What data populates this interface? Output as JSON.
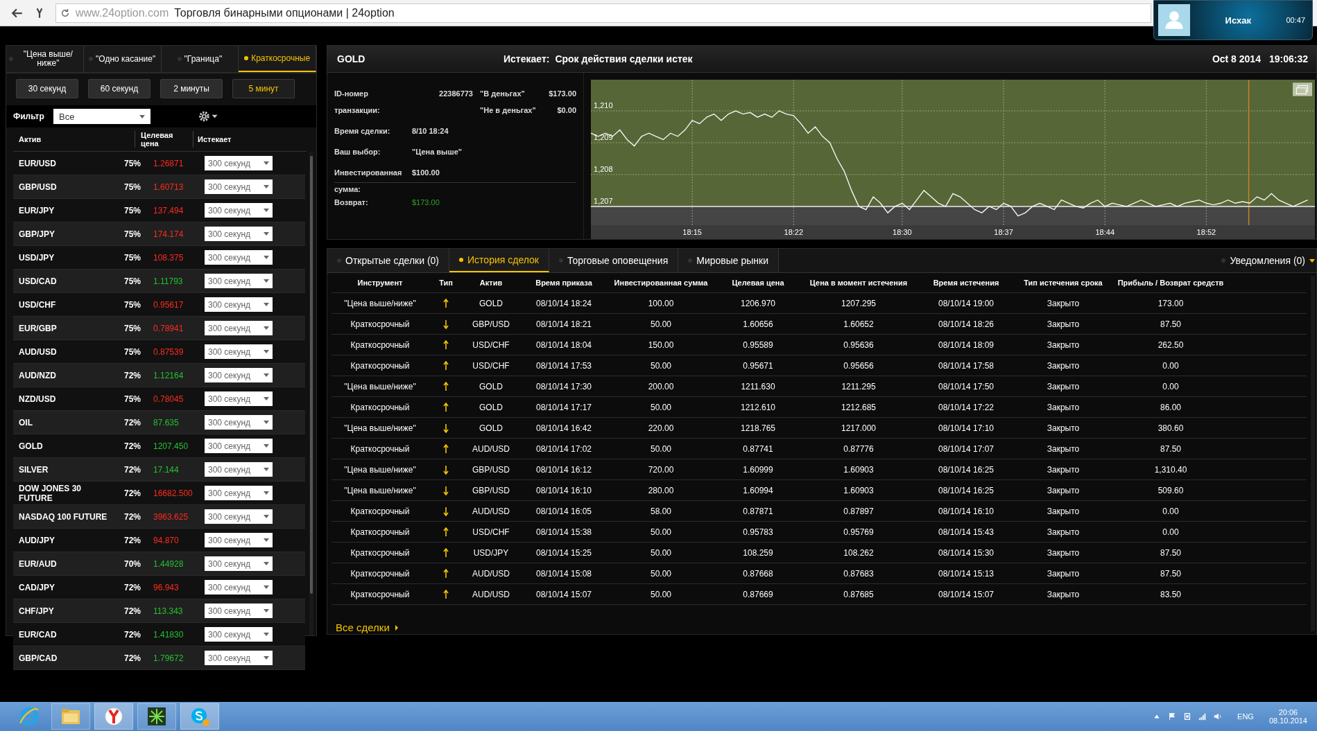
{
  "browser": {
    "url": "www.24option.com",
    "title": "Торговля бинарными опционами | 24option"
  },
  "notification": {
    "name": "Исхак",
    "time": "00:47"
  },
  "left_panel": {
    "tabs": [
      {
        "label": "\"Цена выше/ ниже\"",
        "selected": false
      },
      {
        "label": "\"Одно касание\"",
        "selected": false
      },
      {
        "label": "\"Граница\"",
        "selected": false
      },
      {
        "label": "Краткосрочные",
        "selected": true
      }
    ],
    "durations": [
      {
        "label": "30 секунд",
        "selected": false
      },
      {
        "label": "60 секунд",
        "selected": false
      },
      {
        "label": "2 минуты",
        "selected": false
      },
      {
        "label": "5 минут",
        "selected": true
      }
    ],
    "filter": {
      "label": "Фильтр",
      "value": "Все"
    },
    "columns": [
      "Актив",
      "Целевая цена",
      "Истекает"
    ],
    "assets": [
      {
        "name": "EUR/USD",
        "payout": "75%",
        "price": "1.26871",
        "color": "#ff2a1f",
        "expiry": "300 секунд"
      },
      {
        "name": "GBP/USD",
        "payout": "75%",
        "price": "1.60713",
        "color": "#ff2a1f",
        "expiry": "300 секунд"
      },
      {
        "name": "EUR/JPY",
        "payout": "75%",
        "price": "137.494",
        "color": "#ff2a1f",
        "expiry": "300 секунд"
      },
      {
        "name": "GBP/JPY",
        "payout": "75%",
        "price": "174.174",
        "color": "#ff2a1f",
        "expiry": "300 секунд"
      },
      {
        "name": "USD/JPY",
        "payout": "75%",
        "price": "108.375",
        "color": "#ff2a1f",
        "expiry": "300 секунд"
      },
      {
        "name": "USD/CAD",
        "payout": "75%",
        "price": "1.11793",
        "color": "#22c32e",
        "expiry": "300 секунд"
      },
      {
        "name": "USD/CHF",
        "payout": "75%",
        "price": "0.95617",
        "color": "#ff2a1f",
        "expiry": "300 секунд"
      },
      {
        "name": "EUR/GBP",
        "payout": "75%",
        "price": "0.78941",
        "color": "#ff2a1f",
        "expiry": "300 секунд"
      },
      {
        "name": "AUD/USD",
        "payout": "75%",
        "price": "0.87539",
        "color": "#ff2a1f",
        "expiry": "300 секунд"
      },
      {
        "name": "AUD/NZD",
        "payout": "72%",
        "price": "1.12164",
        "color": "#22c32e",
        "expiry": "300 секунд"
      },
      {
        "name": "NZD/USD",
        "payout": "75%",
        "price": "0.78045",
        "color": "#ff2a1f",
        "expiry": "300 секунд"
      },
      {
        "name": "OIL",
        "payout": "72%",
        "price": "87.635",
        "color": "#22c32e",
        "expiry": "300 секунд"
      },
      {
        "name": "GOLD",
        "payout": "72%",
        "price": "1207.450",
        "color": "#22c32e",
        "expiry": "300 секунд"
      },
      {
        "name": "SILVER",
        "payout": "72%",
        "price": "17.144",
        "color": "#22c32e",
        "expiry": "300 секунд"
      },
      {
        "name": "DOW JONES 30 FUTURE",
        "payout": "72%",
        "price": "16682.500",
        "color": "#ff2a1f",
        "expiry": "300 секунд"
      },
      {
        "name": "NASDAQ 100 FUTURE",
        "payout": "72%",
        "price": "3963.625",
        "color": "#ff2a1f",
        "expiry": "300 секунд"
      },
      {
        "name": "AUD/JPY",
        "payout": "72%",
        "price": "94.870",
        "color": "#ff2a1f",
        "expiry": "300 секунд"
      },
      {
        "name": "EUR/AUD",
        "payout": "70%",
        "price": "1.44928",
        "color": "#22c32e",
        "expiry": "300 секунд"
      },
      {
        "name": "CAD/JPY",
        "payout": "72%",
        "price": "96.943",
        "color": "#ff2a1f",
        "expiry": "300 секунд"
      },
      {
        "name": "CHF/JPY",
        "payout": "72%",
        "price": "113.343",
        "color": "#22c32e",
        "expiry": "300 секунд"
      },
      {
        "name": "EUR/CAD",
        "payout": "72%",
        "price": "1.41830",
        "color": "#22c32e",
        "expiry": "300 секунд"
      },
      {
        "name": "GBP/CAD",
        "payout": "72%",
        "price": "1.79672",
        "color": "#22c32e",
        "expiry": "300 секунд"
      }
    ]
  },
  "trade": {
    "asset": "GOLD",
    "expires_label": "Истекает:",
    "expires_value": "Срок действия сделки истек",
    "date": "Oct 8 2014",
    "time": "19:06:32",
    "fields": [
      {
        "label": "ID-номер транзакции:",
        "value": "22386773"
      },
      {
        "label": "Время сделки:",
        "value": "8/10 18:24"
      },
      {
        "label": "Ваш выбор:",
        "value": "\"Цена выше\""
      },
      {
        "label": "Инвестированная сумма:",
        "value": "$100.00"
      }
    ],
    "outcomes": [
      {
        "label": "\"В деньгах\"",
        "value": "$173.00"
      },
      {
        "label": "\"Не в деньгах\"",
        "value": "$0.00"
      }
    ],
    "return": {
      "label": "Возврат:",
      "value": "$173.00"
    },
    "chart_data": {
      "type": "line",
      "ylim": [
        1206.41,
        1210.98
      ],
      "categories": [
        null,
        null,
        null,
        null,
        null,
        null,
        null,
        null,
        null,
        null,
        null,
        null,
        null,
        null,
        "18:15",
        null,
        null,
        null,
        null,
        null,
        null,
        null,
        null,
        null,
        null,
        null,
        null,
        null,
        "18:22",
        null,
        null,
        null,
        null,
        null,
        null,
        null,
        null,
        null,
        null,
        null,
        null,
        null,
        null,
        "18:30",
        null,
        null,
        null,
        null,
        null,
        null,
        null,
        null,
        null,
        null,
        null,
        null,
        null,
        "18:37",
        null,
        null,
        null,
        null,
        null,
        null,
        null,
        null,
        null,
        null,
        null,
        null,
        null,
        "18:44",
        null,
        null,
        null,
        null,
        null,
        null,
        null,
        null,
        null,
        null,
        null,
        null,
        null,
        "18:52",
        null,
        null,
        null,
        null,
        null,
        null,
        null,
        null,
        null,
        null,
        null,
        null,
        null,
        null
      ],
      "grid": true,
      "ref_lines": [
        {
          "axis": "y",
          "value": 1207,
          "color": "#eeeeee"
        }
      ],
      "series": [
        {
          "color": "#f4f4f4",
          "values": [
            1209.3,
            1209.2,
            1209.3,
            1209.2,
            1209.4,
            1209.1,
            1208.9,
            1209.2,
            1209.3,
            1209.2,
            1209.1,
            1209.3,
            1209.2,
            1209.4,
            1209.7,
            1209.6,
            1209.8,
            1209.9,
            1209.7,
            1209.9,
            1210.0,
            1209.9,
            1209.95,
            1209.8,
            1209.9,
            1209.8,
            1210.0,
            1209.9,
            1209.85,
            1209.6,
            1209.3,
            1209.5,
            1209.2,
            1209.0,
            1208.5,
            1208.1,
            1207.5,
            1207.0,
            1206.9,
            1207.3,
            1207.1,
            1206.8,
            1207.0,
            1207.1,
            1206.9,
            1207.2,
            1207.5,
            1207.3,
            1207.1,
            1207.0,
            1207.4,
            1207.3,
            1207.1,
            1206.9,
            1206.8,
            1207.0,
            1206.9,
            1207.1,
            1207.0,
            1206.7,
            1206.8,
            1207.0,
            1207.1,
            1207.0,
            1206.9,
            1207.2,
            1207.1,
            1207.0,
            1206.95,
            1207.1,
            1207.2,
            1207.0,
            1207.1,
            1207.05,
            1207.0,
            1207.1,
            1207.2,
            1207.1,
            1207.0,
            1207.05,
            1207.1,
            1207.0,
            1207.1,
            1207.15,
            1207.2,
            1207.1,
            1207.05,
            1207.1,
            1207.2,
            1207.1,
            1207.15,
            1207.1,
            1207.3,
            1207.2,
            1207.4,
            1207.2,
            1207.1,
            1207.0,
            1207.1,
            1207.2
          ]
        }
      ],
      "yticks": [
        {
          "value": 1210,
          "label": "1,210"
        },
        {
          "value": 1209,
          "label": "1,209"
        },
        {
          "value": 1208,
          "label": "1,208"
        },
        {
          "value": 1207,
          "label": "1,207"
        }
      ]
    }
  },
  "history": {
    "tabs": [
      {
        "label": "Открытые сделки (0)",
        "selected": false
      },
      {
        "label": "История сделок",
        "selected": true
      },
      {
        "label": "Торговые оповещения",
        "selected": false
      },
      {
        "label": "Мировые рынки",
        "selected": false
      }
    ],
    "notifications": "Уведомления (0)",
    "columns": [
      "Инструмент",
      "Тип",
      "Актив",
      "Время приказа",
      "Инвестированная сумма",
      "Целевая цена",
      "Цена в момент истечения",
      "Время истечения",
      "Тип истечения срока",
      "Прибыль / Возврат средств"
    ],
    "rows": [
      {
        "instrument": "\"Цена выше/ниже\"",
        "kind": "up",
        "asset": "GOLD",
        "order_time": "08/10/14 18:24",
        "invested": "100.00",
        "target": "1206.970",
        "expiry_price": "1207.295",
        "expiry_time": "08/10/14 19:00",
        "expiry_type": "Закрыто",
        "profit": "173.00"
      },
      {
        "instrument": "Краткосрочный",
        "kind": "down",
        "asset": "GBP/USD",
        "order_time": "08/10/14 18:21",
        "invested": "50.00",
        "target": "1.60656",
        "expiry_price": "1.60652",
        "expiry_time": "08/10/14 18:26",
        "expiry_type": "Закрыто",
        "profit": "87.50"
      },
      {
        "instrument": "Краткосрочный",
        "kind": "up",
        "asset": "USD/CHF",
        "order_time": "08/10/14 18:04",
        "invested": "150.00",
        "target": "0.95589",
        "expiry_price": "0.95636",
        "expiry_time": "08/10/14 18:09",
        "expiry_type": "Закрыто",
        "profit": "262.50"
      },
      {
        "instrument": "Краткосрочный",
        "kind": "up",
        "asset": "USD/CHF",
        "order_time": "08/10/14 17:53",
        "invested": "50.00",
        "target": "0.95671",
        "expiry_price": "0.95656",
        "expiry_time": "08/10/14 17:58",
        "expiry_type": "Закрыто",
        "profit": "0.00"
      },
      {
        "instrument": "\"Цена выше/ниже\"",
        "kind": "up",
        "asset": "GOLD",
        "order_time": "08/10/14 17:30",
        "invested": "200.00",
        "target": "1211.630",
        "expiry_price": "1211.295",
        "expiry_time": "08/10/14 17:50",
        "expiry_type": "Закрыто",
        "profit": "0.00"
      },
      {
        "instrument": "Краткосрочный",
        "kind": "up",
        "asset": "GOLD",
        "order_time": "08/10/14 17:17",
        "invested": "50.00",
        "target": "1212.610",
        "expiry_price": "1212.685",
        "expiry_time": "08/10/14 17:22",
        "expiry_type": "Закрыто",
        "profit": "86.00"
      },
      {
        "instrument": "\"Цена выше/ниже\"",
        "kind": "down",
        "asset": "GOLD",
        "order_time": "08/10/14 16:42",
        "invested": "220.00",
        "target": "1218.765",
        "expiry_price": "1217.000",
        "expiry_time": "08/10/14 17:10",
        "expiry_type": "Закрыто",
        "profit": "380.60"
      },
      {
        "instrument": "Краткосрочный",
        "kind": "up",
        "asset": "AUD/USD",
        "order_time": "08/10/14 17:02",
        "invested": "50.00",
        "target": "0.87741",
        "expiry_price": "0.87776",
        "expiry_time": "08/10/14 17:07",
        "expiry_type": "Закрыто",
        "profit": "87.50"
      },
      {
        "instrument": "\"Цена выше/ниже\"",
        "kind": "down",
        "asset": "GBP/USD",
        "order_time": "08/10/14 16:12",
        "invested": "720.00",
        "target": "1.60999",
        "expiry_price": "1.60903",
        "expiry_time": "08/10/14 16:25",
        "expiry_type": "Закрыто",
        "profit": "1,310.40"
      },
      {
        "instrument": "\"Цена выше/ниже\"",
        "kind": "down",
        "asset": "GBP/USD",
        "order_time": "08/10/14 16:10",
        "invested": "280.00",
        "target": "1.60994",
        "expiry_price": "1.60903",
        "expiry_time": "08/10/14 16:25",
        "expiry_type": "Закрыто",
        "profit": "509.60"
      },
      {
        "instrument": "Краткосрочный",
        "kind": "down",
        "asset": "AUD/USD",
        "order_time": "08/10/14 16:05",
        "invested": "58.00",
        "target": "0.87871",
        "expiry_price": "0.87897",
        "expiry_time": "08/10/14 16:10",
        "expiry_type": "Закрыто",
        "profit": "0.00"
      },
      {
        "instrument": "Краткосрочный",
        "kind": "up",
        "asset": "USD/CHF",
        "order_time": "08/10/14 15:38",
        "invested": "50.00",
        "target": "0.95783",
        "expiry_price": "0.95769",
        "expiry_time": "08/10/14 15:43",
        "expiry_type": "Закрыто",
        "profit": "0.00"
      },
      {
        "instrument": "Краткосрочный",
        "kind": "up",
        "asset": "USD/JPY",
        "order_time": "08/10/14 15:25",
        "invested": "50.00",
        "target": "108.259",
        "expiry_price": "108.262",
        "expiry_time": "08/10/14 15:30",
        "expiry_type": "Закрыто",
        "profit": "87.50"
      },
      {
        "instrument": "Краткосрочный",
        "kind": "up",
        "asset": "AUD/USD",
        "order_time": "08/10/14 15:08",
        "invested": "50.00",
        "target": "0.87668",
        "expiry_price": "0.87683",
        "expiry_time": "08/10/14 15:13",
        "expiry_type": "Закрыто",
        "profit": "87.50"
      },
      {
        "instrument": "Краткосрочный",
        "kind": "up",
        "asset": "AUD/USD",
        "order_time": "08/10/14 15:07",
        "invested": "50.00",
        "target": "0.87669",
        "expiry_price": "0.87685",
        "expiry_time": "08/10/14 15:07",
        "expiry_type": "Закрыто",
        "profit": "83.50"
      }
    ],
    "all_link": "Все сделки"
  },
  "taskbar": {
    "language": "ENG",
    "time": "20:06",
    "date": "08.10.2014"
  }
}
